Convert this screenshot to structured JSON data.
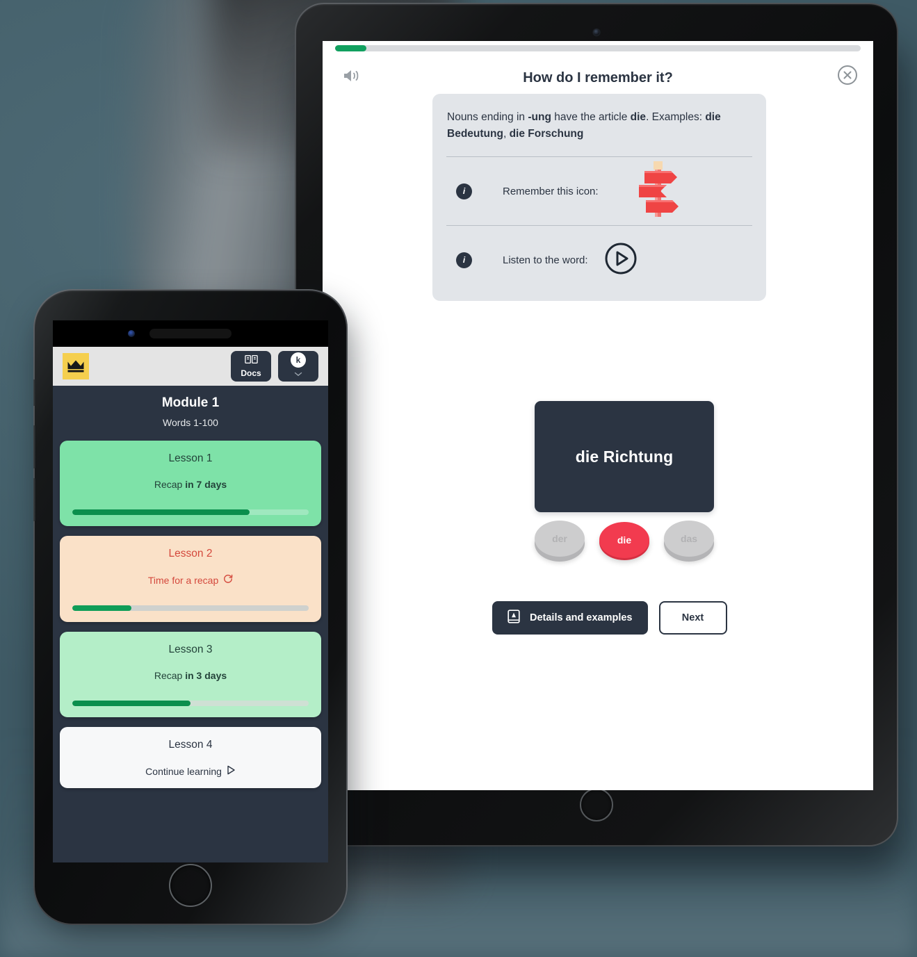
{
  "scene": {
    "background_color": "#4a6570"
  },
  "tablet": {
    "app": {
      "progress_percent": 6,
      "speaker_icon": "speaker-icon",
      "close_icon": "close-icon",
      "title": "How do I remember it?",
      "hint": {
        "rule_parts": [
          {
            "text": "Nouns ending in ",
            "bold": false
          },
          {
            "text": "-ung",
            "bold": true
          },
          {
            "text": " have the article ",
            "bold": false
          },
          {
            "text": "die",
            "bold": true
          },
          {
            "text": ". Examples: ",
            "bold": false
          },
          {
            "text": "die Bedeutung",
            "bold": true
          },
          {
            "text": ", ",
            "bold": false
          },
          {
            "text": "die Forschung",
            "bold": true
          }
        ],
        "rows": [
          {
            "info": "i",
            "label": "Remember this icon:",
            "media": "signpost-icon"
          },
          {
            "info": "i",
            "label": "Listen to the word:",
            "media": "play-icon"
          }
        ]
      },
      "word_card": {
        "text": "die Richtung",
        "background": "#2b3442"
      },
      "articles": [
        {
          "label": "der",
          "selected": false
        },
        {
          "label": "die",
          "selected": true
        },
        {
          "label": "das",
          "selected": false
        }
      ],
      "accent_color": "#f23b4f",
      "buttons": {
        "details": {
          "label": "Details and examples",
          "icon": "book-page-icon"
        },
        "next": {
          "label": "Next"
        }
      }
    }
  },
  "phone": {
    "topbar": {
      "logo_icon": "crown-logo-icon",
      "logo_background": "#f5cf4e",
      "docs_button": {
        "label": "Docs",
        "icon": "book-icon"
      },
      "account_button": {
        "initial": "k",
        "chevron_icon": "chevron-down-icon"
      }
    },
    "module": {
      "title": "Module 1",
      "subtitle": "Words 1-100"
    },
    "lessons": [
      {
        "name": "Lesson 1",
        "status_prefix": "Recap ",
        "status_strong": "in 7 days",
        "status_icon": "",
        "progress_percent": 75,
        "card_background": "#7ee2a8",
        "text_color": "#23433a",
        "track_color": "#9fe8bf",
        "fill_color": "#0b8f4d"
      },
      {
        "name": "Lesson 2",
        "status_prefix": "Time for a recap ",
        "status_strong": "",
        "status_icon": "refresh-icon",
        "progress_percent": 25,
        "card_background": "#fae1c8",
        "text_color": "#d4483c",
        "track_color": "#cfd1ce",
        "fill_color": "#0f9d58"
      },
      {
        "name": "Lesson 3",
        "status_prefix": "Recap ",
        "status_strong": "in 3 days",
        "status_icon": "",
        "progress_percent": 50,
        "card_background": "#b4eec8",
        "text_color": "#23433a",
        "track_color": "#cfe0d4",
        "fill_color": "#0b8f4d"
      },
      {
        "name": "Lesson 4",
        "status_prefix": "Continue learning ",
        "status_strong": "",
        "status_icon": "play-triangle-icon",
        "progress_percent": 0,
        "card_background": "#f7f8f9",
        "text_color": "#2b3442",
        "track_color": "#f7f8f9",
        "fill_color": "#0f9d58"
      }
    ]
  }
}
